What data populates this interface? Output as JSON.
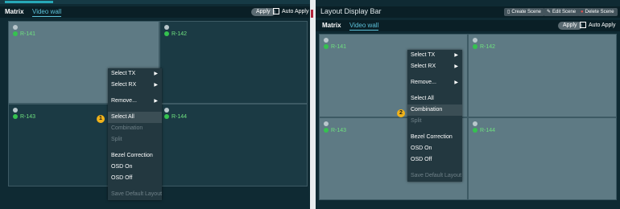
{
  "left": {
    "tabs": {
      "matrix": "Matrix",
      "video_wall": "Video wall"
    },
    "apply_label": "Apply",
    "auto_apply_label": "Auto Apply",
    "cells": [
      "R-141",
      "R-142",
      "R-143",
      "R-144"
    ],
    "context_menu": {
      "items": [
        "Select TX",
        "Select RX",
        "Remove...",
        "Select All",
        "Combination",
        "Split",
        "Bezel Correction",
        "OSD On",
        "OSD Off",
        "Save Default Layout"
      ],
      "highlighted": "Select All",
      "disabled": [
        "Combination",
        "Split",
        "Save Default Layout"
      ]
    },
    "step_badge": "1"
  },
  "right": {
    "title": "Layout Display Bar",
    "scene_buttons": {
      "create": "Create Scene",
      "edit": "Edit Scene",
      "delete": "Delete Scene"
    },
    "tabs": {
      "matrix": "Matrix",
      "video_wall": "Video wall"
    },
    "apply_label": "Apply",
    "auto_apply_label": "Auto Apply",
    "cells": [
      "R-141",
      "R-142",
      "R-143",
      "R-144"
    ],
    "context_menu": {
      "items": [
        "Select TX",
        "Select RX",
        "Remove...",
        "Select All",
        "Combination",
        "Split",
        "Bezel Correction",
        "OSD On",
        "OSD Off",
        "Save Default Layout"
      ],
      "highlighted": "Combination",
      "disabled": [
        "Split",
        "Save Default Layout"
      ]
    },
    "step_badge": "2"
  },
  "colors": {
    "accent": "#5cc1d9",
    "badge": "#f0b21a",
    "rx_green": "#35c24f"
  },
  "icons": {
    "submenu": "chevron-right-icon",
    "create": "scene-create-icon",
    "edit": "scene-edit-icon",
    "delete": "scene-delete-icon"
  }
}
